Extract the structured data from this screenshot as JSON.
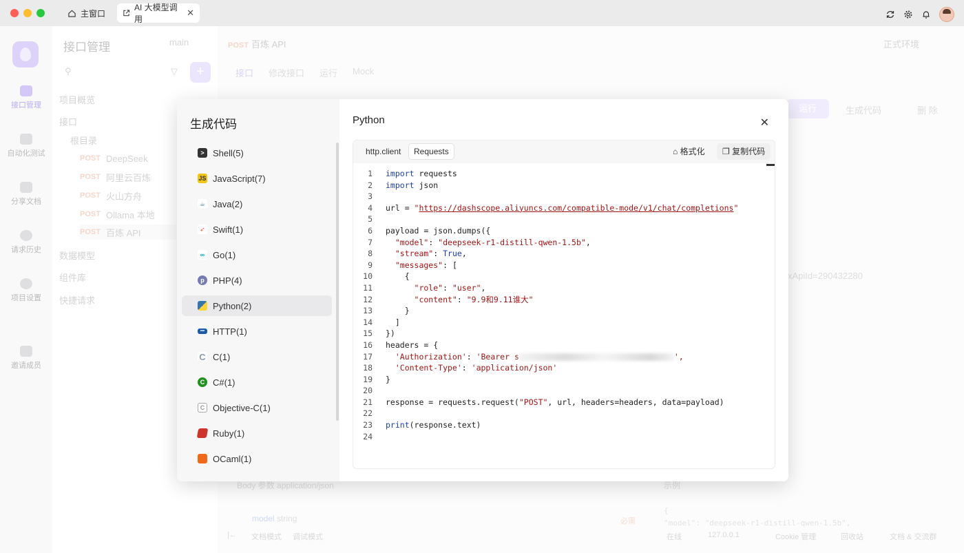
{
  "window": {
    "tabs": [
      {
        "label": "主窗口"
      },
      {
        "label": "AI 大模型调用"
      }
    ]
  },
  "leftnav": {
    "items": [
      {
        "label": "接口管理"
      },
      {
        "label": "自动化测试"
      },
      {
        "label": "分享文档"
      },
      {
        "label": "请求历史"
      },
      {
        "label": "项目设置"
      },
      {
        "label": "邀请成员"
      }
    ]
  },
  "sidebar": {
    "title": "接口管理",
    "tree": [
      {
        "label": "项目概览"
      },
      {
        "label": "接口"
      },
      {
        "label": "根目录"
      },
      {
        "method": "POST",
        "label": "DeepSeek"
      },
      {
        "method": "POST",
        "label": "阿里云百炼"
      },
      {
        "method": "POST",
        "label": "火山方舟"
      },
      {
        "method": "POST",
        "label": "Ollama 本地"
      },
      {
        "method": "POST",
        "label": "百炼 API"
      },
      {
        "label": "数据模型"
      },
      {
        "label": "组件库"
      },
      {
        "label": "快捷请求"
      }
    ]
  },
  "main": {
    "branch": "main",
    "api_method": "POST",
    "api_name": "百炼 API",
    "env": "正式环境",
    "subtabs": [
      "接口",
      "修改接口",
      "运行",
      "Mock"
    ],
    "run_label": "运行",
    "gen_label": "生成代码",
    "delete_label": "删 除",
    "apiid_text": "xApiId=290432280",
    "body_param": "Body 参数",
    "body_type": "application/json",
    "example": "示例",
    "field_name": "model",
    "field_type": "string",
    "required": "必需",
    "json_snip": [
      "{",
      "  \"model\": \"deepseek-r1-distill-qwen-1.5b\","
    ]
  },
  "statusbar": {
    "doc_mode": "文档模式",
    "debug_mode": "调试模式",
    "online": "在线",
    "host": "127.0.0.1",
    "cookie": "Cookie 管理",
    "recycle": "回收站",
    "community": "文档 & 交流群"
  },
  "modal": {
    "title": "生成代码",
    "lang_title": "Python",
    "languages": [
      {
        "label": "Shell(5)",
        "icon": "terminal-icon",
        "color": "#333333"
      },
      {
        "label": "JavaScript(7)",
        "icon": "js-icon",
        "color": "#f0c419"
      },
      {
        "label": "Java(2)",
        "icon": "java-icon",
        "color": "#5382a1"
      },
      {
        "label": "Swift(1)",
        "icon": "swift-icon",
        "color": "#f05138"
      },
      {
        "label": "Go(1)",
        "icon": "go-icon",
        "color": "#00add8"
      },
      {
        "label": "PHP(4)",
        "icon": "php-icon",
        "color": "#777bb3"
      },
      {
        "label": "Python(2)",
        "icon": "python-icon",
        "color": "#3776ab"
      },
      {
        "label": "HTTP(1)",
        "icon": "http-icon",
        "color": "#1e5aa8"
      },
      {
        "label": "C(1)",
        "icon": "c-icon",
        "color": "#a8b9cc"
      },
      {
        "label": "C#(1)",
        "icon": "csharp-icon",
        "color": "#239120"
      },
      {
        "label": "Objective-C(1)",
        "icon": "objc-icon",
        "color": "#999999"
      },
      {
        "label": "Ruby(1)",
        "icon": "ruby-icon",
        "color": "#cc342d"
      },
      {
        "label": "OCaml(1)",
        "icon": "ocaml-icon",
        "color": "#ee6a1a"
      }
    ],
    "selected_language": "Python(2)",
    "code_tabs": [
      "http.client",
      "Requests"
    ],
    "active_code_tab": "Requests",
    "format_label": "格式化",
    "copy_label": "复制代码",
    "code_lines": {
      "l1a": "import",
      "l1b": " requests",
      "l2a": "import",
      "l2b": " json",
      "l4a": "url = ",
      "l4b": "\"",
      "l4url": "https://dashscope.aliyuncs.com/compatible-mode/v1/chat/completions",
      "l4c": "\"",
      "l6": "payload = json.dumps({",
      "l7a": "  \"model\"",
      "l7b": ": ",
      "l7c": "\"deepseek-r1-distill-qwen-1.5b\"",
      "l7d": ",",
      "l8a": "  \"stream\"",
      "l8b": ": ",
      "l8c": "True",
      "l8d": ",",
      "l9a": "  \"messages\"",
      "l9b": ": [",
      "l10": "    {",
      "l11a": "      \"role\"",
      "l11b": ": ",
      "l11c": "\"user\"",
      "l11d": ",",
      "l12a": "      \"content\"",
      "l12b": ": ",
      "l12c": "\"9.9和9.11谁大\"",
      "l13": "    }",
      "l14": "  ]",
      "l15": "})",
      "l16": "headers = {",
      "l17a": "  'Authorization'",
      "l17b": ": ",
      "l17c": "'Bearer s",
      "l17d": "',",
      "l18a": "  'Content-Type'",
      "l18b": ": ",
      "l18c": "'application/json'",
      "l19": "}",
      "l21a": "response = requests.request(",
      "l21b": "\"POST\"",
      "l21c": ", url, headers=headers, data=payload)",
      "l23a": "print",
      "l23b": "(response.text)"
    }
  }
}
